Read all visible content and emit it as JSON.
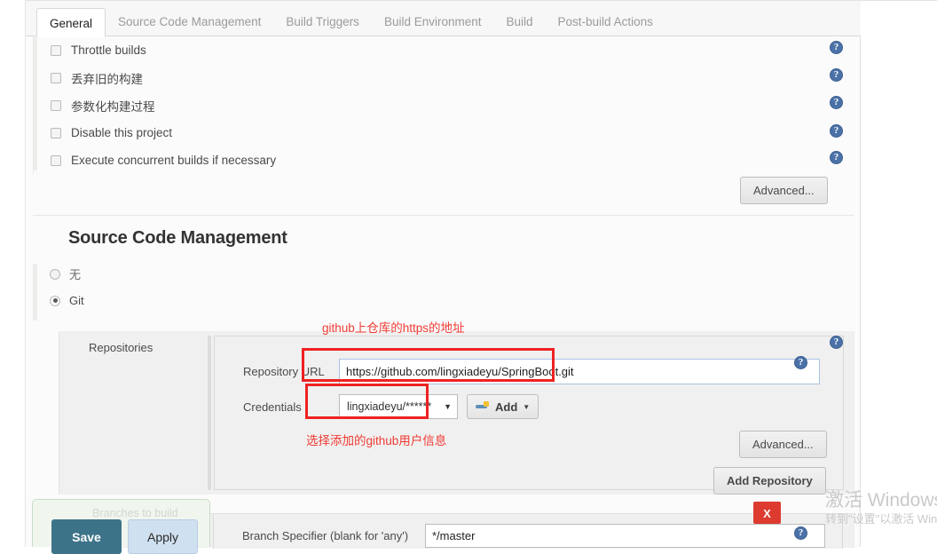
{
  "tabs": [
    {
      "label": "General",
      "active": true
    },
    {
      "label": "Source Code Management",
      "active": false
    },
    {
      "label": "Build Triggers",
      "active": false
    },
    {
      "label": "Build Environment",
      "active": false
    },
    {
      "label": "Build",
      "active": false
    },
    {
      "label": "Post-build Actions",
      "active": false
    }
  ],
  "general": {
    "checkboxes": [
      {
        "label": "Throttle builds",
        "checked": false
      },
      {
        "label": "丢弃旧的构建",
        "checked": false
      },
      {
        "label": "参数化构建过程",
        "checked": false
      },
      {
        "label": "Disable this project",
        "checked": false
      },
      {
        "label": "Execute concurrent builds if necessary",
        "checked": false
      }
    ],
    "advanced_label": "Advanced..."
  },
  "scm": {
    "title": "Source Code Management",
    "options": [
      {
        "label": "无",
        "selected": false
      },
      {
        "label": "Git",
        "selected": true
      }
    ],
    "repositories_label": "Repositories",
    "repository_url_label": "Repository URL",
    "repository_url_value": "https://github.com/lingxiadeyu/SpringBoot.git",
    "credentials_label": "Credentials",
    "credentials_value": "lingxiadeyu/******",
    "add_button_label": "Add",
    "advanced_label": "Advanced...",
    "add_repository_label": "Add Repository",
    "branches_to_build_label": "Branches to build",
    "branch_specifier_label": "Branch Specifier (blank for 'any')",
    "branch_specifier_value": "*/master"
  },
  "annotations": [
    {
      "text": "github上仓库的https的地址"
    },
    {
      "text": "选择添加的github用户信息"
    }
  ],
  "buttons": {
    "save": "Save",
    "apply": "Apply",
    "close": "X"
  },
  "help_icon_glyph": "?",
  "watermark": {
    "line1": "激活 Windows",
    "line2": "转到\"设置\"以激活 Windows。"
  },
  "colors": {
    "accent_red": "#ee2222",
    "save_teal": "#3d7389",
    "apply_blue": "#cfe0f0",
    "help_blue": "#4b72a8",
    "close_red": "#dd3b30"
  }
}
